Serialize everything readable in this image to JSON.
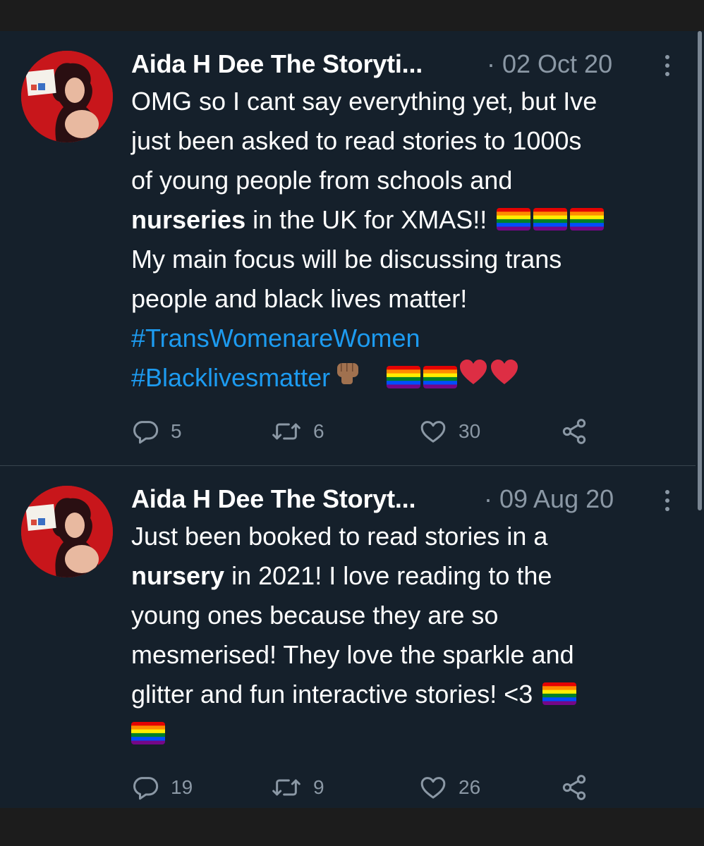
{
  "colors": {
    "background": "#15202b",
    "text": "#ffffff",
    "muted": "#8b98a5",
    "hashtag": "#1d9bf0",
    "divider": "#38444d",
    "heart": "#e0245e"
  },
  "tweets": [
    {
      "author": "Aida H Dee The Storyti...",
      "date": "· 02 Oct 20",
      "lines": [
        [
          "OMG so I cant say everything yet, but Ive"
        ],
        [
          "just been asked to read stories to 1000s"
        ],
        [
          "of young people from schools and"
        ],
        [
          "nurseries",
          " in the UK for XMAS!!"
        ],
        [
          "My main focus will be discussing trans"
        ],
        [
          "people and black lives matter!"
        ],
        [
          "#TransWomenareWomen"
        ],
        [
          "#Blacklivesmatter"
        ]
      ],
      "emoji": [
        "rainbow-flag",
        "raised-fist",
        "red-heart"
      ],
      "replies": "5",
      "retweets": "6",
      "likes": "30"
    },
    {
      "author": "Aida H Dee The Storyt...",
      "date": "· 09 Aug 20",
      "lines": [
        [
          "Just been booked to read stories in a"
        ],
        [
          "nursery",
          " in 2021! I love reading to the"
        ],
        [
          "young ones because they are so"
        ],
        [
          "mesmerised! They love the sparkle and"
        ],
        [
          "glitter and fun interactive stories! <3"
        ]
      ],
      "emoji": [
        "rainbow-flag"
      ],
      "replies": "19",
      "retweets": "9",
      "likes": "26"
    }
  ],
  "icons": [
    "reply-icon",
    "retweet-icon",
    "like-icon",
    "share-icon",
    "more-icon"
  ]
}
